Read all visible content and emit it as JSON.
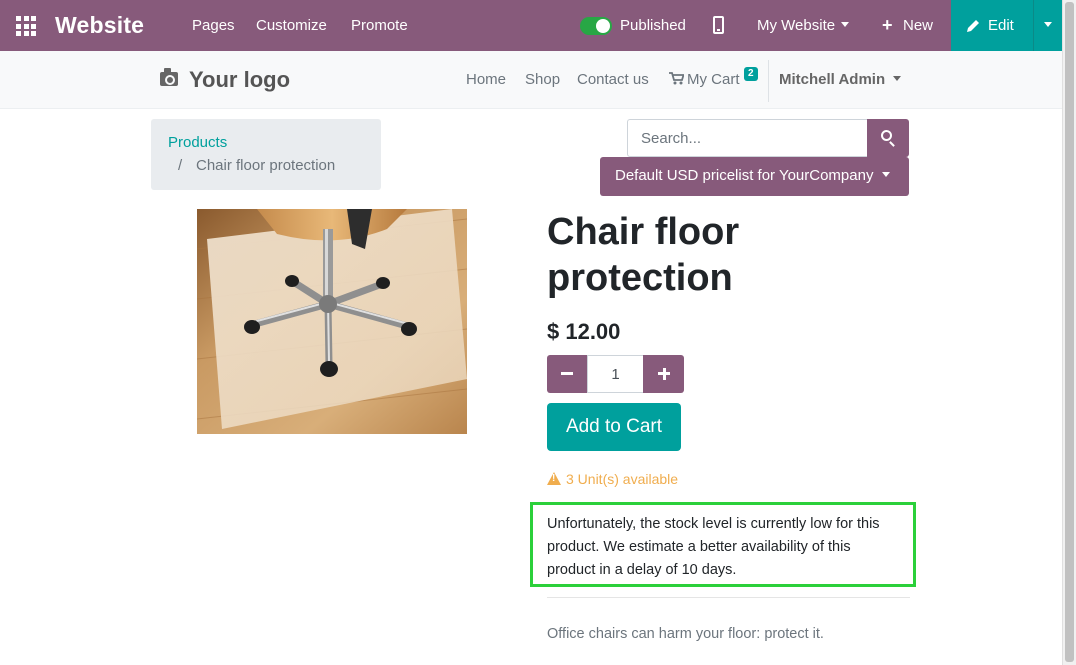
{
  "admin_bar": {
    "app_name": "Website",
    "menu": [
      "Pages",
      "Customize",
      "Promote"
    ],
    "published_label": "Published",
    "my_website_label": "My Website",
    "new_label": "New",
    "edit_label": "Edit",
    "colors": {
      "bar": "#875a7b",
      "edit": "#00a09d",
      "toggle_on": "#28a745"
    }
  },
  "site_nav": {
    "logo_text": "Your logo",
    "links": [
      "Home",
      "Shop",
      "Contact us"
    ],
    "cart_label": "My Cart",
    "cart_count": "2",
    "user_name": "Mitchell Admin"
  },
  "breadcrumb": {
    "parent": "Products",
    "separator": "/",
    "current": "Chair floor protection"
  },
  "search": {
    "placeholder": "Search..."
  },
  "pricelist": {
    "label": "Default USD pricelist for YourCompany"
  },
  "product": {
    "name": "Chair floor protection",
    "price": "$ 12.00",
    "quantity": "1",
    "add_to_cart_label": "Add to Cart",
    "availability": "3 Unit(s) available",
    "stock_message": "Unfortunately, the stock level is currently low for this product. We estimate a better availability of this product in a delay of 10 days.",
    "description": "Office chairs can harm your floor: protect it."
  }
}
